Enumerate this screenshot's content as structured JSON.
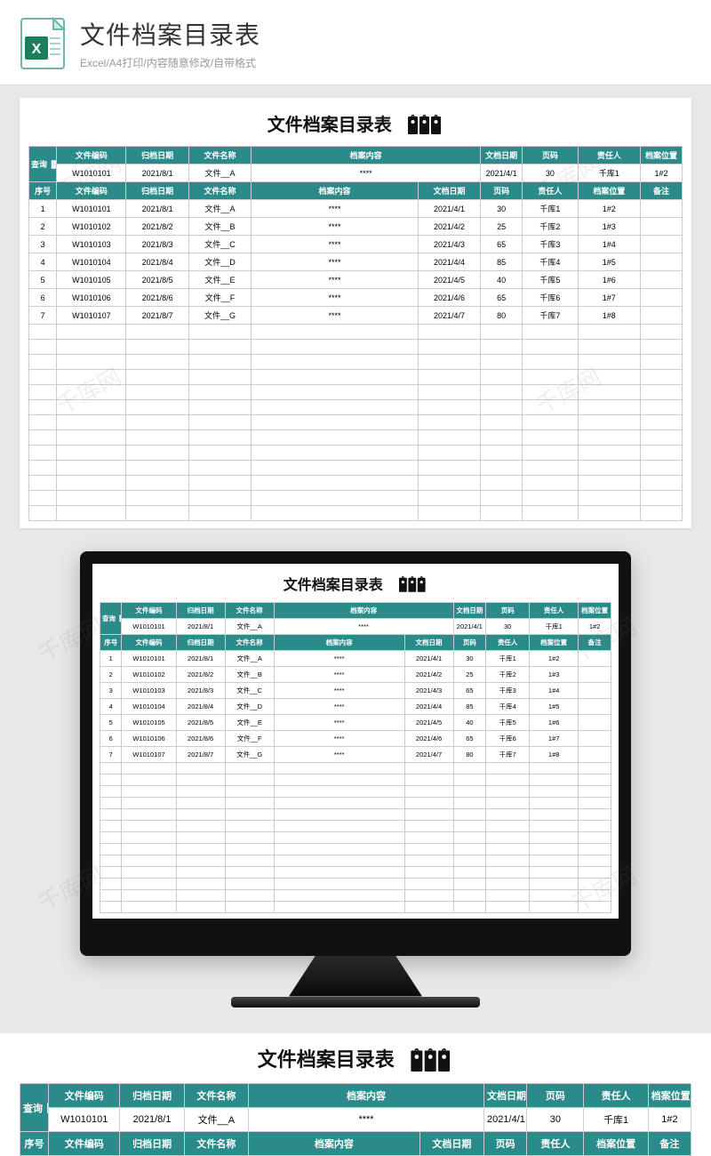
{
  "header": {
    "title": "文件档案目录表",
    "subtitle": "Excel/A4打印/内容随意修改/自带格式"
  },
  "sheet": {
    "title": "文件档案目录表",
    "search_label": "查询",
    "search_headers": [
      "文件编码",
      "归档日期",
      "文件名称",
      "档案内容",
      "文档日期",
      "页码",
      "责任人",
      "档案位置"
    ],
    "search_row": [
      "W1010101",
      "2021/8/1",
      "文件__A",
      "****",
      "2021/4/1",
      "30",
      "千库1",
      "1#2"
    ],
    "table_headers": [
      "序号",
      "文件编码",
      "归档日期",
      "文件名称",
      "档案内容",
      "文档日期",
      "页码",
      "责任人",
      "档案位置",
      "备注"
    ],
    "rows": [
      [
        "1",
        "W1010101",
        "2021/8/1",
        "文件__A",
        "****",
        "2021/4/1",
        "30",
        "千库1",
        "1#2",
        ""
      ],
      [
        "2",
        "W1010102",
        "2021/8/2",
        "文件__B",
        "****",
        "2021/4/2",
        "25",
        "千库2",
        "1#3",
        ""
      ],
      [
        "3",
        "W1010103",
        "2021/8/3",
        "文件__C",
        "****",
        "2021/4/3",
        "65",
        "千库3",
        "1#4",
        ""
      ],
      [
        "4",
        "W1010104",
        "2021/8/4",
        "文件__D",
        "****",
        "2021/4/4",
        "85",
        "千库4",
        "1#5",
        ""
      ],
      [
        "5",
        "W1010105",
        "2021/8/5",
        "文件__E",
        "****",
        "2021/4/5",
        "40",
        "千库5",
        "1#6",
        ""
      ],
      [
        "6",
        "W1010106",
        "2021/8/6",
        "文件__F",
        "****",
        "2021/4/6",
        "65",
        "千库6",
        "1#7",
        ""
      ],
      [
        "7",
        "W1010107",
        "2021/8/7",
        "文件__G",
        "****",
        "2021/4/7",
        "80",
        "千库7",
        "1#8",
        ""
      ]
    ],
    "empty_rows_main": 13,
    "empty_rows_monitor": 13
  },
  "colors": {
    "teal": "#2b8a8a",
    "page_bg": "#e8e8e8"
  },
  "watermark": "千库网"
}
